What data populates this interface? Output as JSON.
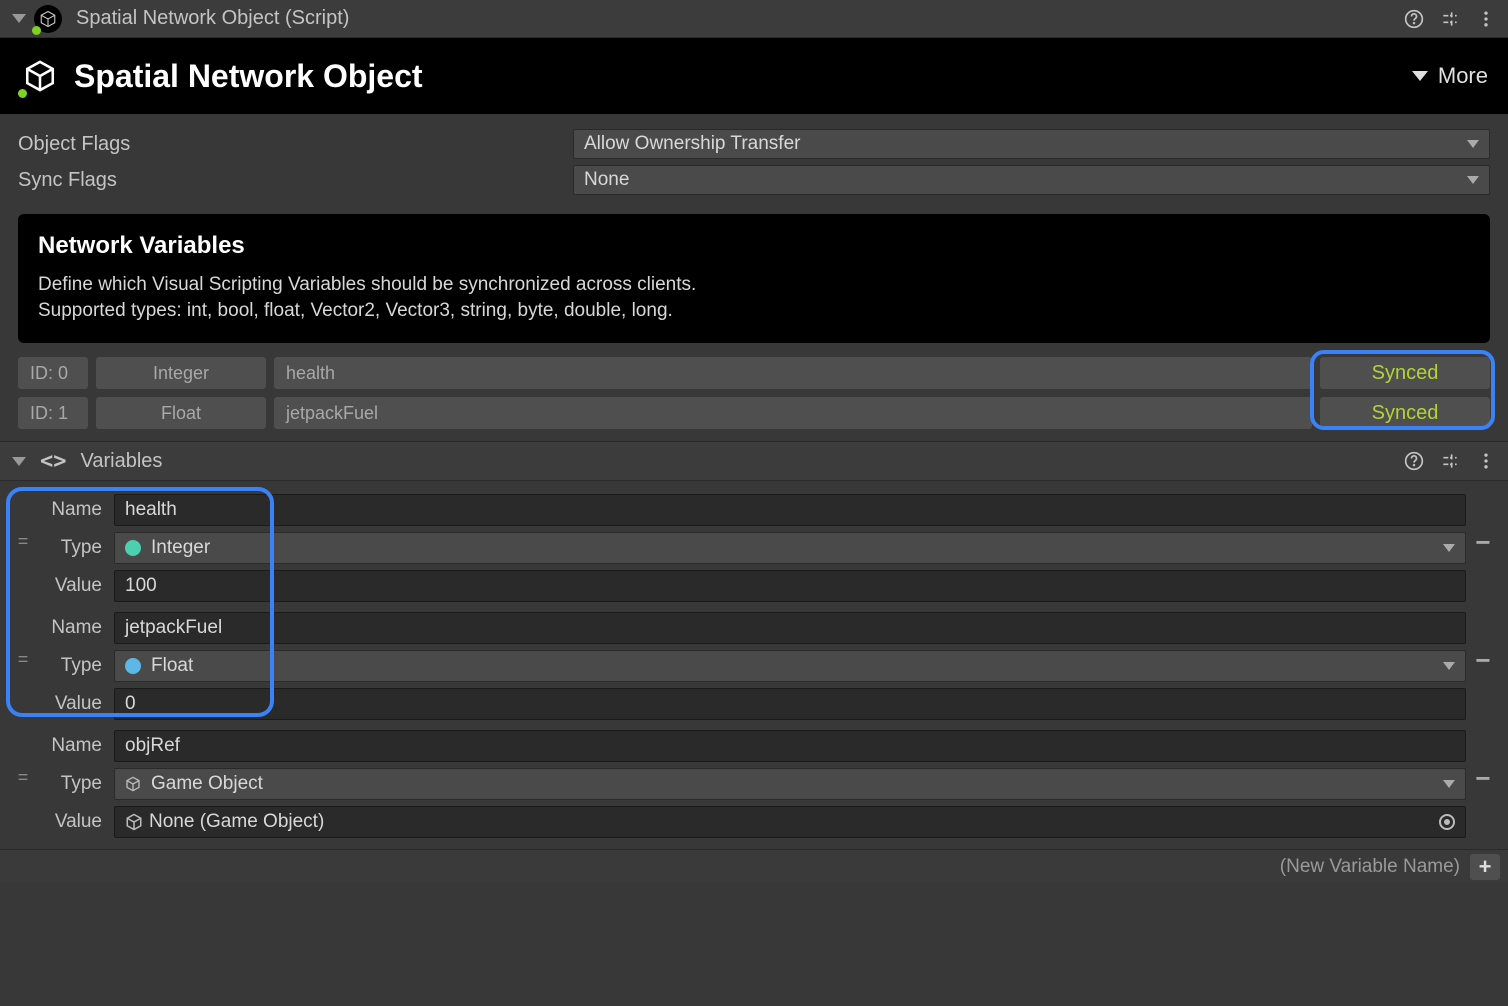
{
  "component": {
    "header_title": "Spatial Network Object (Script)",
    "big_title": "Spatial Network Object",
    "more_label": "More"
  },
  "properties": {
    "object_flags": {
      "label": "Object Flags",
      "value": "Allow Ownership Transfer"
    },
    "sync_flags": {
      "label": "Sync Flags",
      "value": "None"
    }
  },
  "network_variables": {
    "title": "Network Variables",
    "description_line1": "Define which Visual Scripting Variables should be synchronized across clients.",
    "description_line2": "Supported types: int, bool, float, Vector2, Vector3, string, byte, double, long.",
    "rows": [
      {
        "id": "ID: 0",
        "type": "Integer",
        "name": "health",
        "status": "Synced"
      },
      {
        "id": "ID: 1",
        "type": "Float",
        "name": "jetpackFuel",
        "status": "Synced"
      }
    ]
  },
  "variables_section": {
    "title": "Variables",
    "labels": {
      "name": "Name",
      "type": "Type",
      "value": "Value"
    },
    "entries": [
      {
        "name": "health",
        "type": "Integer",
        "type_kind": "integer",
        "value": "100"
      },
      {
        "name": "jetpackFuel",
        "type": "Float",
        "type_kind": "float",
        "value": "0"
      },
      {
        "name": "objRef",
        "type": "Game Object",
        "type_kind": "gameobject",
        "value": "None (Game Object)"
      }
    ],
    "new_placeholder": "(New Variable Name)"
  }
}
